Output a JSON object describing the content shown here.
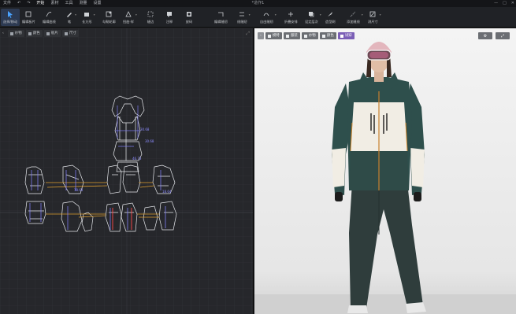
{
  "menubar": {
    "items": [
      "文件",
      "开始",
      "素材",
      "工具",
      "测量",
      "设置"
    ],
    "title": "*造作1",
    "window_controls": [
      "—",
      "□",
      "✕"
    ]
  },
  "toolbar": {
    "tools": [
      {
        "label": "选择/移动",
        "icon": "pointer-icon"
      },
      {
        "label": "编辑板片",
        "icon": "edit-pattern-icon"
      },
      {
        "label": "编辑曲线",
        "icon": "edit-curve-icon"
      },
      {
        "label": "笔",
        "icon": "pen-icon"
      },
      {
        "label": "长方形",
        "icon": "rectangle-icon"
      },
      {
        "label": "勾勒轮廓",
        "icon": "trace-outline-icon"
      },
      {
        "label": "扭曲·样",
        "icon": "transform-icon"
      },
      {
        "label": "缝边",
        "icon": "seam-allowance-icon"
      },
      {
        "label": "注释",
        "icon": "annotation-icon"
      },
      {
        "label": "放码",
        "icon": "grading-icon"
      },
      {
        "label": "编辑缝纫",
        "icon": "edit-sewing-icon"
      },
      {
        "label": "线缝纫",
        "icon": "line-sewing-icon"
      },
      {
        "label": "自由缝纫",
        "icon": "free-sewing-icon"
      },
      {
        "label": "折叠安排",
        "icon": "fold-arrangement-icon"
      },
      {
        "label": "设定层次",
        "icon": "layer-icon"
      },
      {
        "label": "造型刷",
        "icon": "shape-brush-icon"
      },
      {
        "label": "添加缝线",
        "icon": "add-stitch-icon"
      },
      {
        "label": "测尺寸",
        "icon": "measure-icon"
      }
    ]
  },
  "left_panel": {
    "tabs": [
      "纱物",
      "颜色",
      "板片",
      "尺寸"
    ]
  },
  "right_panel": {
    "tabs": [
      "模特",
      "服装",
      "纱物",
      "颜色",
      "试穿"
    ],
    "tools": [
      "gear-icon",
      "expand-icon"
    ]
  },
  "colors": {
    "accent": "#2d3a52",
    "purple": "#7b5fb6",
    "jacket_teal": "#2e4f4c",
    "jacket_cream": "#f1ede4",
    "pants": "#2f3d3c",
    "hat_pink": "#e3b6bd"
  }
}
